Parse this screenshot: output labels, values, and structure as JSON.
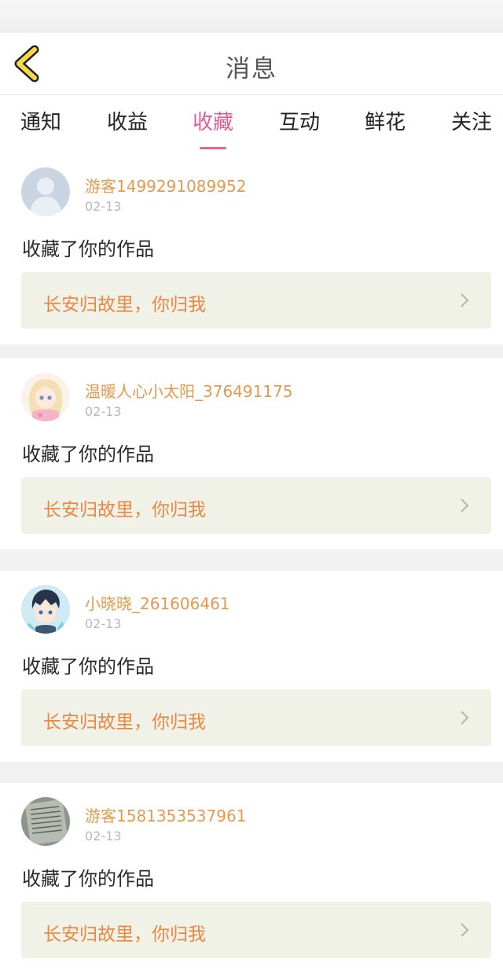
{
  "header": {
    "title": "消息"
  },
  "tabs": [
    {
      "label": "通知"
    },
    {
      "label": "收益"
    },
    {
      "label": "收藏"
    },
    {
      "label": "互动"
    },
    {
      "label": "鲜花"
    },
    {
      "label": "关注"
    }
  ],
  "active_tab": "收藏",
  "items": [
    {
      "username": "游客1499291089952",
      "date": "02-13",
      "action": "收藏了你的作品",
      "work": "长安归故里，你归我",
      "avatar": "default-avatar-icon"
    },
    {
      "username": "温暖人心小太阳_376491175",
      "date": "02-13",
      "action": "收藏了你的作品",
      "work": "长安归故里，你归我",
      "avatar": "anime-girl-avatar"
    },
    {
      "username": "小晓晓_261606461",
      "date": "02-13",
      "action": "收藏了你的作品",
      "work": "长安归故里，你归我",
      "avatar": "anime-boy-avatar"
    },
    {
      "username": "游客1581353537961",
      "date": "02-13",
      "action": "收藏了你的作品",
      "work": "长安归故里，你归我",
      "avatar": "paper-photo-avatar"
    }
  ],
  "colors": {
    "accent_pink": "#de5e95",
    "username_orange": "#e49a4d",
    "work_title_orange": "#ea8743",
    "back_arrow_yellow": "#f5d94a"
  }
}
